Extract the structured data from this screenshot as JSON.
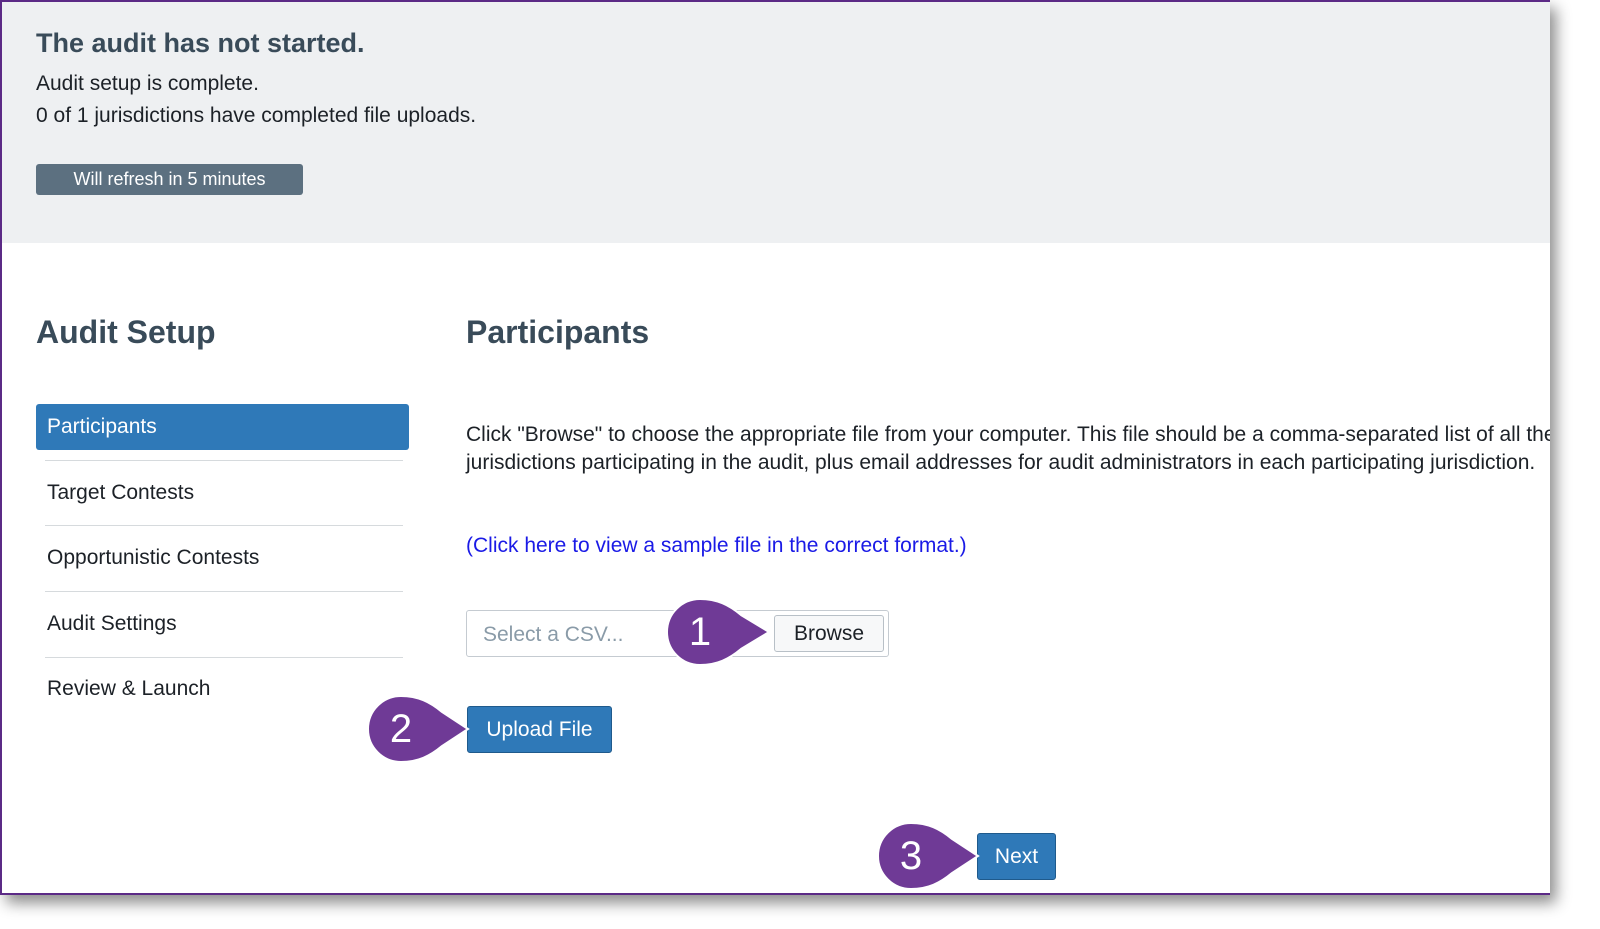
{
  "banner": {
    "title": "The audit has not started.",
    "line1": "Audit setup is complete.",
    "line2": "0 of 1 jurisdictions have completed file uploads.",
    "refresh_label": "Will refresh in 5 minutes"
  },
  "sidebar": {
    "title": "Audit Setup",
    "items": [
      {
        "label": "Participants",
        "active": true
      },
      {
        "label": "Target Contests",
        "active": false
      },
      {
        "label": "Opportunistic Contests",
        "active": false
      },
      {
        "label": "Audit Settings",
        "active": false
      },
      {
        "label": "Review & Launch",
        "active": false
      }
    ]
  },
  "main": {
    "title": "Participants",
    "instructions": "Click \"Browse\" to choose the appropriate file from your computer. This file should be a comma-separated list of all the jurisdictions participating in the audit, plus email addresses for audit administrators in each participating jurisdiction.",
    "sample_link": "(Click here to view a sample file in the correct format.)",
    "file_placeholder": "Select a CSV...",
    "browse_label": "Browse",
    "upload_label": "Upload File",
    "next_label": "Next"
  },
  "callouts": [
    "1",
    "2",
    "3"
  ],
  "colors": {
    "accent": "#2f79b8",
    "callout": "#6f3a96",
    "banner_bg": "#eef0f2",
    "refresh_btn": "#5c7080",
    "link": "#1a1ae6"
  }
}
